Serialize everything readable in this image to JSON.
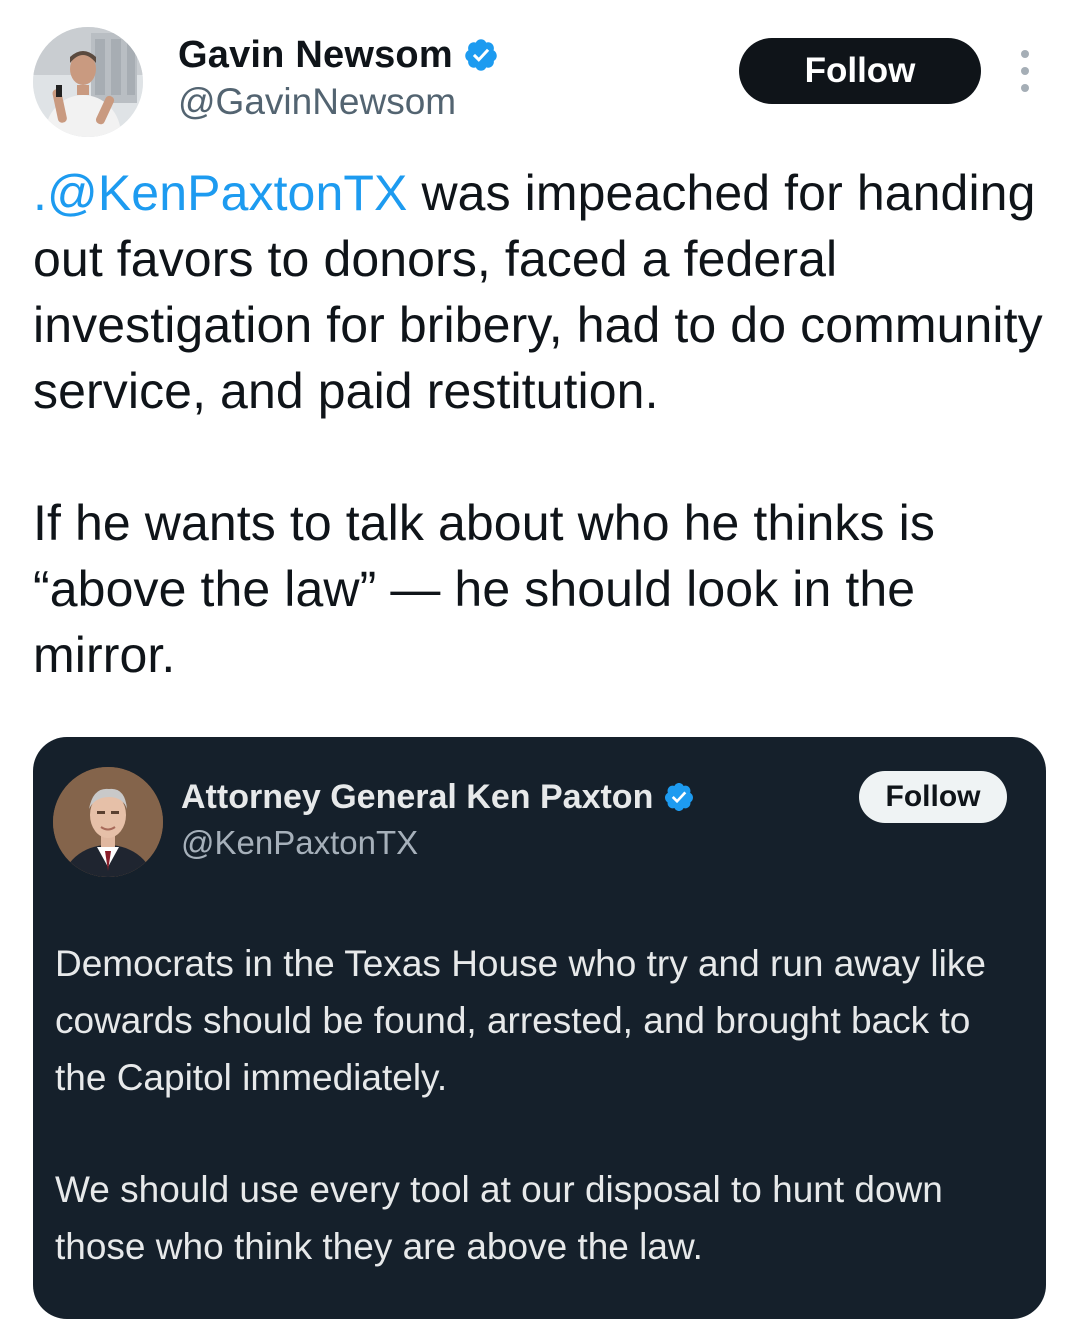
{
  "author": {
    "display_name": "Gavin Newsom",
    "handle": "@GavinNewsom",
    "verified": true,
    "avatar_icon": "user-photo-avatar"
  },
  "actions": {
    "follow_label": "Follow",
    "more_icon": "more-vertical-icon"
  },
  "tweet": {
    "mention": ".@KenPaxtonTX",
    "paragraph_1_rest": " was impeached for handing out favors to donors, faced a federal investigation for bribery, had to do community service, and paid restitution.",
    "paragraph_2": "If he wants to talk about who he thinks is “above the law” — he should look in the mirror."
  },
  "quoted": {
    "display_name": "Attorney General Ken Paxton",
    "handle": "@KenPaxtonTX",
    "verified": true,
    "follow_label": "Follow",
    "paragraph_1": "Democrats in the Texas House who try and run away like cowards should be found, arrested, and brought back to the Capitol immediately.",
    "paragraph_2": "We should use every tool at our disposal to hunt down those who think they are above the law."
  },
  "colors": {
    "link": "#1d9bf0",
    "verified_badge": "#1d9bf0",
    "quote_background": "#15202b",
    "follow_button": "#0f1419"
  }
}
